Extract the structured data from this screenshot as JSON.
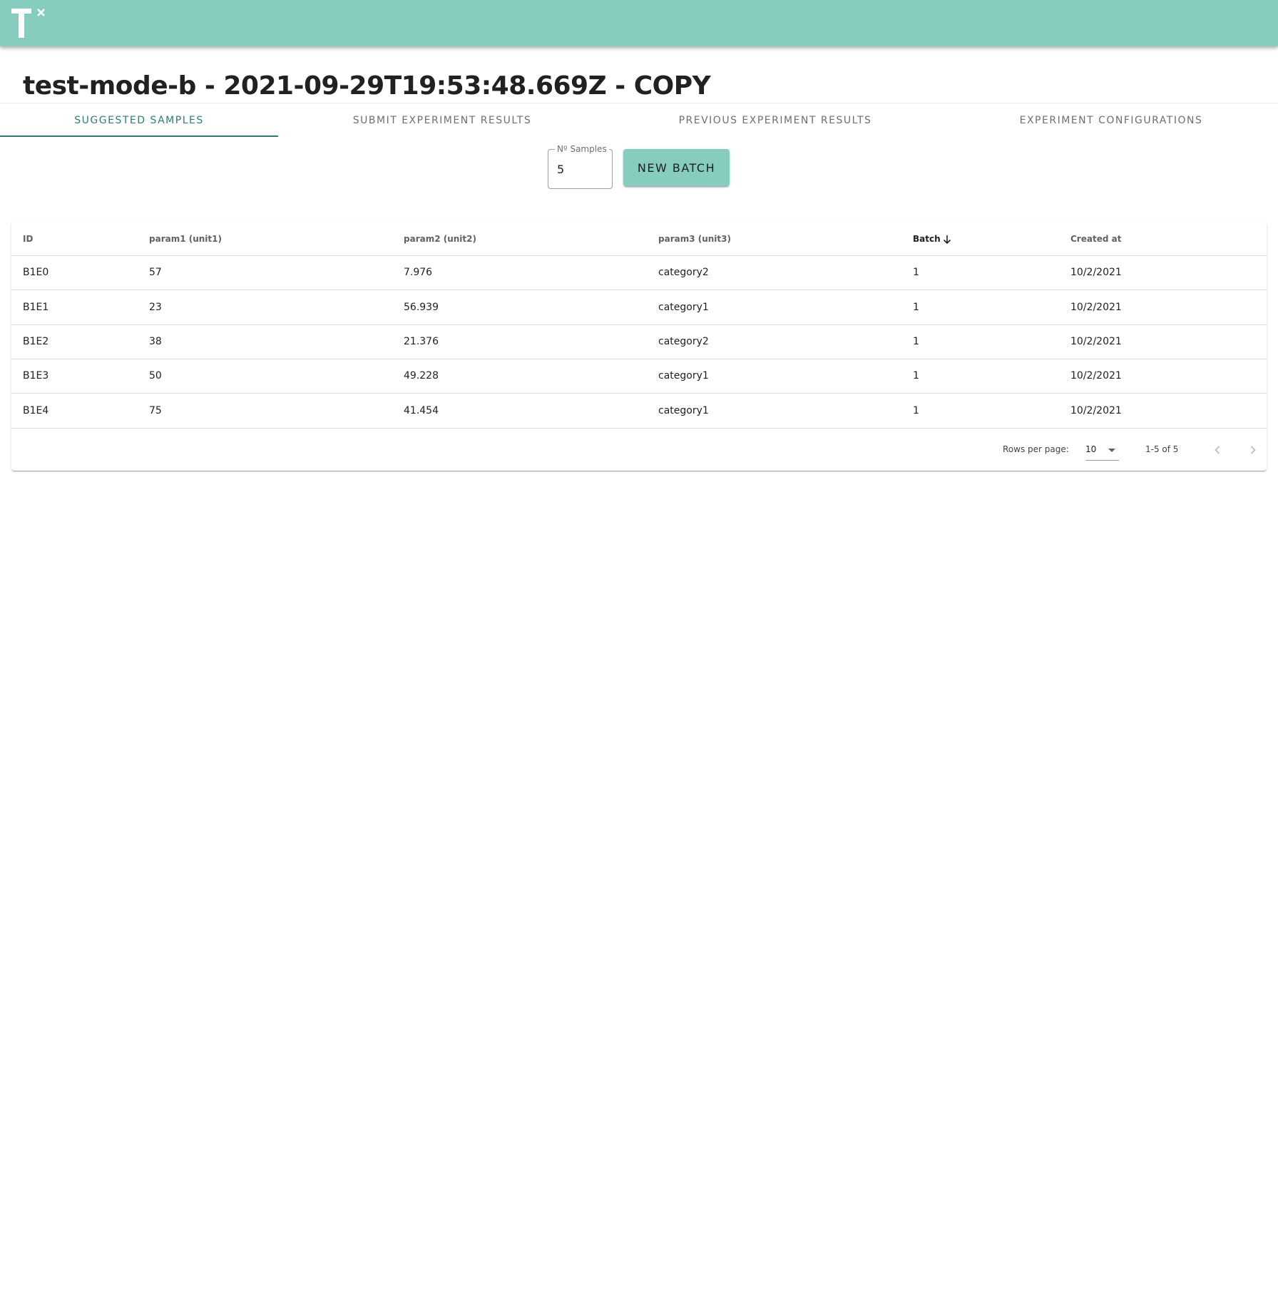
{
  "page": {
    "title": "test-mode-b - 2021-09-29T19:53:48.669Z - COPY"
  },
  "tabs": [
    {
      "label": "SUGGESTED SAMPLES",
      "active": true
    },
    {
      "label": "SUBMIT EXPERIMENT RESULTS",
      "active": false
    },
    {
      "label": "PREVIOUS EXPERIMENT RESULTS",
      "active": false
    },
    {
      "label": "EXPERIMENT CONFIGURATIONS",
      "active": false
    }
  ],
  "controls": {
    "samples_label": "Nº Samples",
    "samples_value": "5",
    "new_batch_label": "NEW BATCH"
  },
  "table": {
    "columns": [
      "ID",
      "param1 (unit1)",
      "param2 (unit2)",
      "param3 (unit3)",
      "Batch",
      "Created at"
    ],
    "sorted_column": "Batch",
    "sort_direction": "descending",
    "rows": [
      [
        "B1E0",
        "57",
        "7.976",
        "category2",
        "1",
        "10/2/2021"
      ],
      [
        "B1E1",
        "23",
        "56.939",
        "category1",
        "1",
        "10/2/2021"
      ],
      [
        "B1E2",
        "38",
        "21.376",
        "category2",
        "1",
        "10/2/2021"
      ],
      [
        "B1E3",
        "50",
        "49.228",
        "category1",
        "1",
        "10/2/2021"
      ],
      [
        "B1E4",
        "75",
        "41.454",
        "category1",
        "1",
        "10/2/2021"
      ]
    ]
  },
  "pagination": {
    "rows_per_page_label": "Rows per page:",
    "rows_per_page_value": "10",
    "range_text": "1-5 of 5"
  },
  "colors": {
    "appbar": "#87cdbf",
    "accent": "#2e7d6e",
    "button": "#87cdbf"
  },
  "icons": {
    "logo": "tx-logo-icon",
    "sort": "arrow-down-icon",
    "prev": "chevron-left-icon",
    "next": "chevron-right-icon",
    "dropdown": "caret-down-icon"
  }
}
